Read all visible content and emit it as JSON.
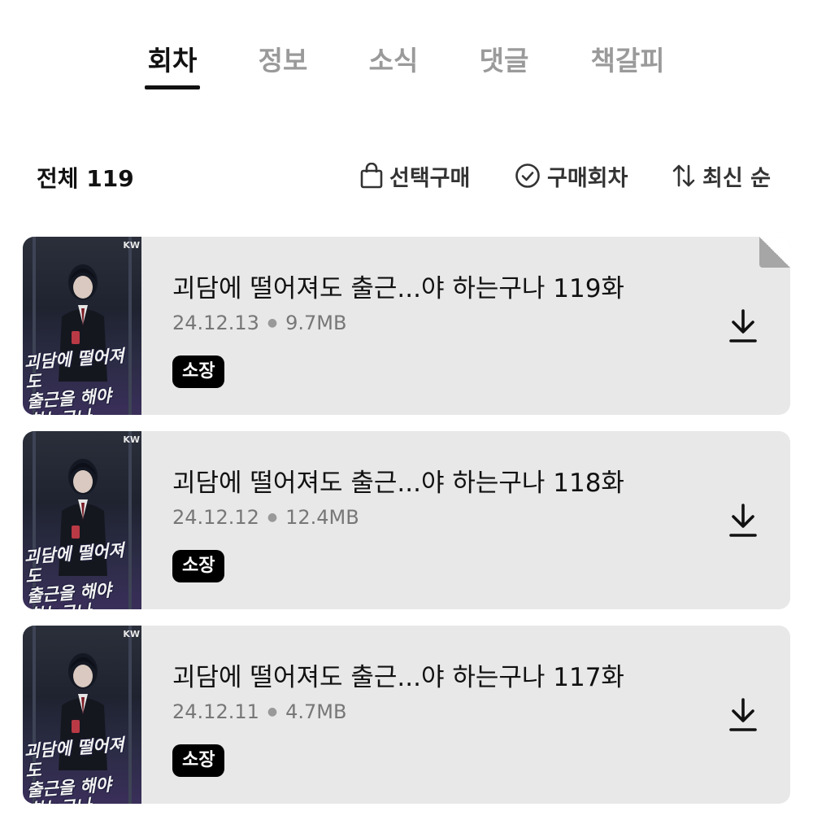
{
  "tabs": [
    {
      "label": "회차",
      "active": true
    },
    {
      "label": "정보",
      "active": false
    },
    {
      "label": "소식",
      "active": false
    },
    {
      "label": "댓글",
      "active": false
    },
    {
      "label": "책갈피",
      "active": false
    }
  ],
  "toolbar": {
    "total_label": "전체 119",
    "select_purchase_label": "선택구매",
    "purchased_label": "구매회차",
    "sort_label": "최신 순"
  },
  "episodes": [
    {
      "title": "괴담에 떨어져도 출근...야 하는구나 119화",
      "date": "24.12.13",
      "size": "9.7MB",
      "badge": "소장",
      "is_new": true,
      "thumb_publisher": "KW",
      "thumb_text": "괴담에 떨어져도\n출근을 해야\n하는구나"
    },
    {
      "title": "괴담에 떨어져도 출근...야 하는구나 118화",
      "date": "24.12.12",
      "size": "12.4MB",
      "badge": "소장",
      "is_new": false,
      "thumb_publisher": "KW",
      "thumb_text": "괴담에 떨어져도\n출근을 해야\n하는구나"
    },
    {
      "title": "괴담에 떨어져도 출근...야 하는구나 117화",
      "date": "24.12.11",
      "size": "4.7MB",
      "badge": "소장",
      "is_new": false,
      "thumb_publisher": "KW",
      "thumb_text": "괴담에 떨어져도\n출근을 해야\n하는구나"
    }
  ],
  "icons": {
    "select_purchase": "shopping-bag-icon",
    "purchased": "check-circle-icon",
    "sort": "sort-arrows-icon",
    "download": "download-icon"
  }
}
